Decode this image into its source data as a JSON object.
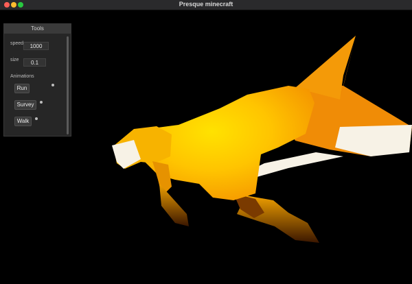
{
  "window": {
    "title": "Presque minecraft"
  },
  "panel": {
    "title": "Tools",
    "speed_label": "speed",
    "speed_value": "1000",
    "size_label": "size",
    "size_value": "0.1",
    "animations_label": "Animations",
    "animations": [
      "Run",
      "Survey",
      "Walk"
    ]
  },
  "colors": {
    "fox_orange": "#f29a0a",
    "fox_yellow": "#ffd000",
    "fox_white": "#f7f2e6",
    "background": "#000000"
  }
}
